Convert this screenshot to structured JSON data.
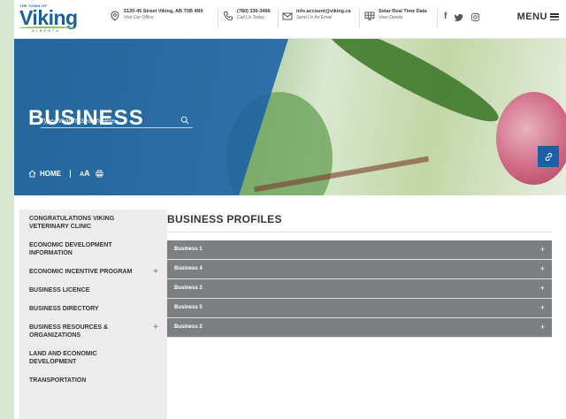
{
  "header": {
    "logo": {
      "small": "THE TOWN OF",
      "main": "Viking",
      "sub": "ALBERTA"
    },
    "address": {
      "line1": "5120-45 Street Viking, AB T0B 4N0",
      "line2": "Visit Our Office",
      "icon": "location-pin-icon"
    },
    "phone": {
      "line1": "(780) 336-3466",
      "line2": "Call Us Today",
      "icon": "phone-icon"
    },
    "email": {
      "line1": "info.account@viking.ca",
      "line2": "Send Us An Email",
      "icon": "envelope-icon"
    },
    "solar": {
      "line1": "Solar Real Time Data",
      "line2": "View Details",
      "icon": "solar-panel-icon"
    },
    "social": [
      "facebook-icon",
      "twitter-icon",
      "instagram-icon"
    ],
    "menu_label": "MENU"
  },
  "hero": {
    "title": "BUSINESS",
    "search_placeholder": "Type What To Search Here",
    "home_label": "HOME",
    "font_small": "A",
    "font_large": "A"
  },
  "sidebar": {
    "items": [
      {
        "label": "CONGRATULATIONS VIKING VETERINARY CLINIC",
        "expandable": false
      },
      {
        "label": "ECONOMIC DEVELOPMENT INFORMATION",
        "expandable": false
      },
      {
        "label": "ECONOMIC INCENTIVE PROGRAM",
        "expandable": true
      },
      {
        "label": "BUSINESS LICENCE",
        "expandable": false
      },
      {
        "label": "BUSINESS DIRECTORY",
        "expandable": false
      },
      {
        "label": "BUSINESS RESOURCES & ORGANIZATIONS",
        "expandable": true
      },
      {
        "label": "LAND AND ECONOMIC DEVELOPMENT",
        "expandable": false
      },
      {
        "label": "TRANSPORTATION",
        "expandable": false
      }
    ],
    "plus_symbol": "+"
  },
  "main": {
    "title": "BUSINESS PROFILES",
    "accordion": [
      {
        "label": "Business 1"
      },
      {
        "label": "Business 4"
      },
      {
        "label": "Business 3"
      },
      {
        "label": "Business 5"
      },
      {
        "label": "Business 2"
      }
    ],
    "plus_symbol": "+"
  },
  "colors": {
    "brand_blue": "#1c5f9c",
    "hero_overlay": "#185ea8",
    "accent_green": "#3f8f3c",
    "accordion_bg": "#7c8083",
    "sidebar_bg": "#ececec"
  }
}
